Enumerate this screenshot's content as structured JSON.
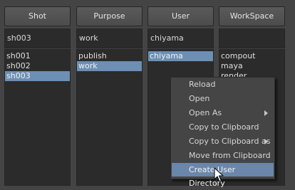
{
  "columns": [
    {
      "header": "Shot",
      "filter": "sh003",
      "items": [
        "sh001",
        "sh002",
        "sh003"
      ],
      "selected": 2
    },
    {
      "header": "Purpose",
      "filter": "work",
      "items": [
        "publish",
        "work"
      ],
      "selected": 1
    },
    {
      "header": "User",
      "filter": "chiyama",
      "items": [
        "chiyama"
      ],
      "selected": 0
    },
    {
      "header": "WorkSpace",
      "filter": "",
      "items": [
        "compout",
        "maya",
        "render"
      ],
      "selected": -1
    }
  ],
  "context_menu": {
    "items": [
      {
        "label": "Reload",
        "submenu": false,
        "hovered": false
      },
      {
        "label": "Open",
        "submenu": false,
        "hovered": false
      },
      {
        "label": "Open As",
        "submenu": true,
        "hovered": false
      },
      {
        "label": "Copy to Clipboard",
        "submenu": false,
        "hovered": false
      },
      {
        "label": "Copy to Clipboard as",
        "submenu": true,
        "hovered": false
      },
      {
        "label": "Move from Clipboard",
        "submenu": false,
        "hovered": false
      },
      {
        "label": "Create User Directory",
        "submenu": false,
        "hovered": true
      }
    ]
  },
  "cursor_icon": "arrow-cursor-icon"
}
